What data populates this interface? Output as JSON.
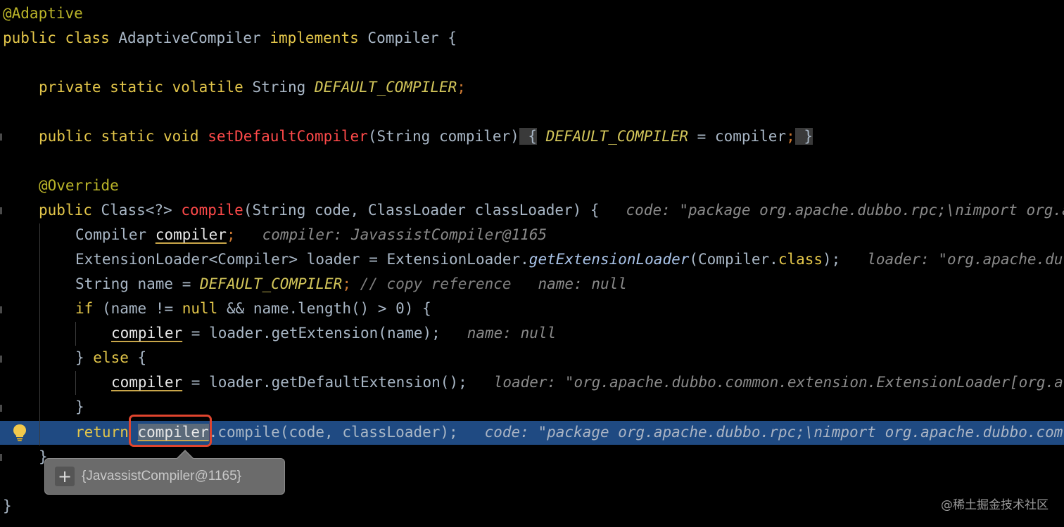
{
  "code": {
    "l1": "@Adaptive",
    "l2_kw1": "public class",
    "l2_name": "AdaptiveCompiler",
    "l2_kw2": "implements",
    "l2_iface": "Compiler",
    "l2_brace": "{",
    "l4_kw": "private static volatile",
    "l4_type": "String",
    "l4_field": "DEFAULT_COMPILER",
    "l4_semi": ";",
    "l6_kw": "public static void",
    "l6_method": "setDefaultCompiler",
    "l6_params": "(String compiler)",
    "l6_open": " {",
    "l6_field": "DEFAULT_COMPILER",
    "l6_assign": " = compiler",
    "l6_semi": ";",
    "l6_close": " }",
    "l8_ann": "@Override",
    "l9_kw": "public",
    "l9_type": "Class<?>",
    "l9_method": "compile",
    "l9_params": "(String code, ClassLoader classLoader) {",
    "l9_hint": "code: \"package org.apache.dubbo.rpc;\\nimport org.a",
    "l10_type": "Compiler",
    "l10_var": "compiler",
    "l10_semi": ";",
    "l10_hint": "compiler: JavassistCompiler@1165",
    "l11_a": "ExtensionLoader<Compiler> loader = ExtensionLoader.",
    "l11_call": "getExtensionLoader",
    "l11_b": "(Compiler.",
    "l11_kw": "class",
    "l11_c": ");",
    "l11_hint": "loader: \"org.apache.du",
    "l12_a": "String name = ",
    "l12_field": "DEFAULT_COMPILER",
    "l12_semi": ";",
    "l12_comment": "// copy reference",
    "l12_hint": "name: null",
    "l13_kw": "if",
    "l13_a": " (name != ",
    "l13_null": "null",
    "l13_b": " && name.length() > 0) {",
    "l14_var": "compiler",
    "l14_a": " = loader.getExtension(name);",
    "l14_hint": "name: null",
    "l15_a": "} ",
    "l15_kw": "else",
    "l15_b": " {",
    "l16_var": "compiler",
    "l16_a": " = loader.getDefaultExtension();",
    "l16_hint": "loader: \"org.apache.dubbo.common.extension.ExtensionLoader[org.a",
    "l17": "}",
    "l18_kw": "return",
    "l18_var": "compiler",
    "l18_a": ".compile(code, classLoader);",
    "l18_hint": "code: \"package org.apache.dubbo.rpc;\\nimport org.apache.dubbo.com",
    "l19": "}",
    "l21": "}"
  },
  "tooltip": {
    "value": "{JavassistCompiler@1165}"
  },
  "watermark": "@稀土掘金技术社区",
  "colors": {
    "background": "#000000",
    "current_line": "#1f4a82",
    "highlight_box": "#e0452e"
  }
}
